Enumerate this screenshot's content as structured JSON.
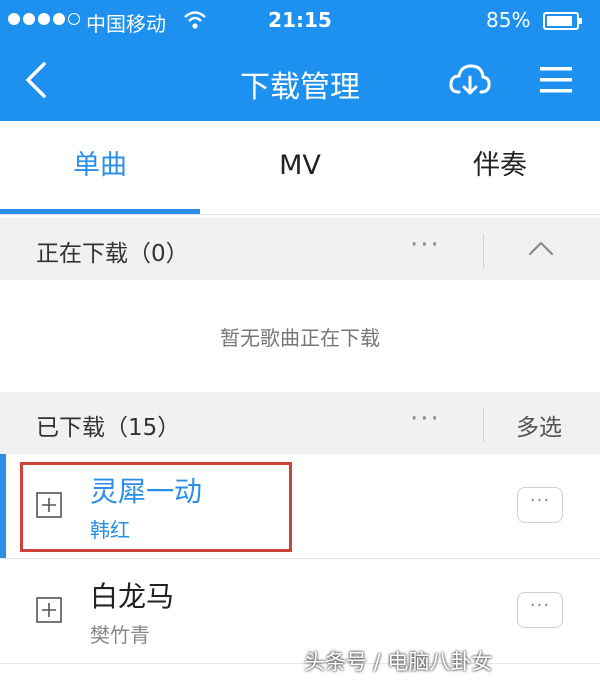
{
  "status_bar": {
    "carrier": "中国移动",
    "time": "21:15",
    "battery": "85%"
  },
  "nav": {
    "title": "下载管理",
    "icons": [
      "back-icon",
      "download-cloud-icon",
      "menu-icon"
    ]
  },
  "tabs": [
    {
      "label": "单曲",
      "active": true
    },
    {
      "label": "MV",
      "active": false
    },
    {
      "label": "伴奏",
      "active": false
    }
  ],
  "downloading": {
    "title": "正在下载（0）",
    "more": "···",
    "empty_text": "暂无歌曲正在下载"
  },
  "downloaded": {
    "title": "已下载（15）",
    "more": "···",
    "multi_select": "多选",
    "songs": [
      {
        "title": "灵犀一动",
        "artist": "韩红",
        "more": "···",
        "playing": true
      },
      {
        "title": "白龙马",
        "artist": "樊竹青",
        "more": "···",
        "playing": false
      }
    ]
  },
  "watermark": "头条号 / 电脑八卦女",
  "colors": {
    "header": "#1e90f0",
    "accent": "#2b8fe8",
    "highlight": "#d0413a"
  }
}
